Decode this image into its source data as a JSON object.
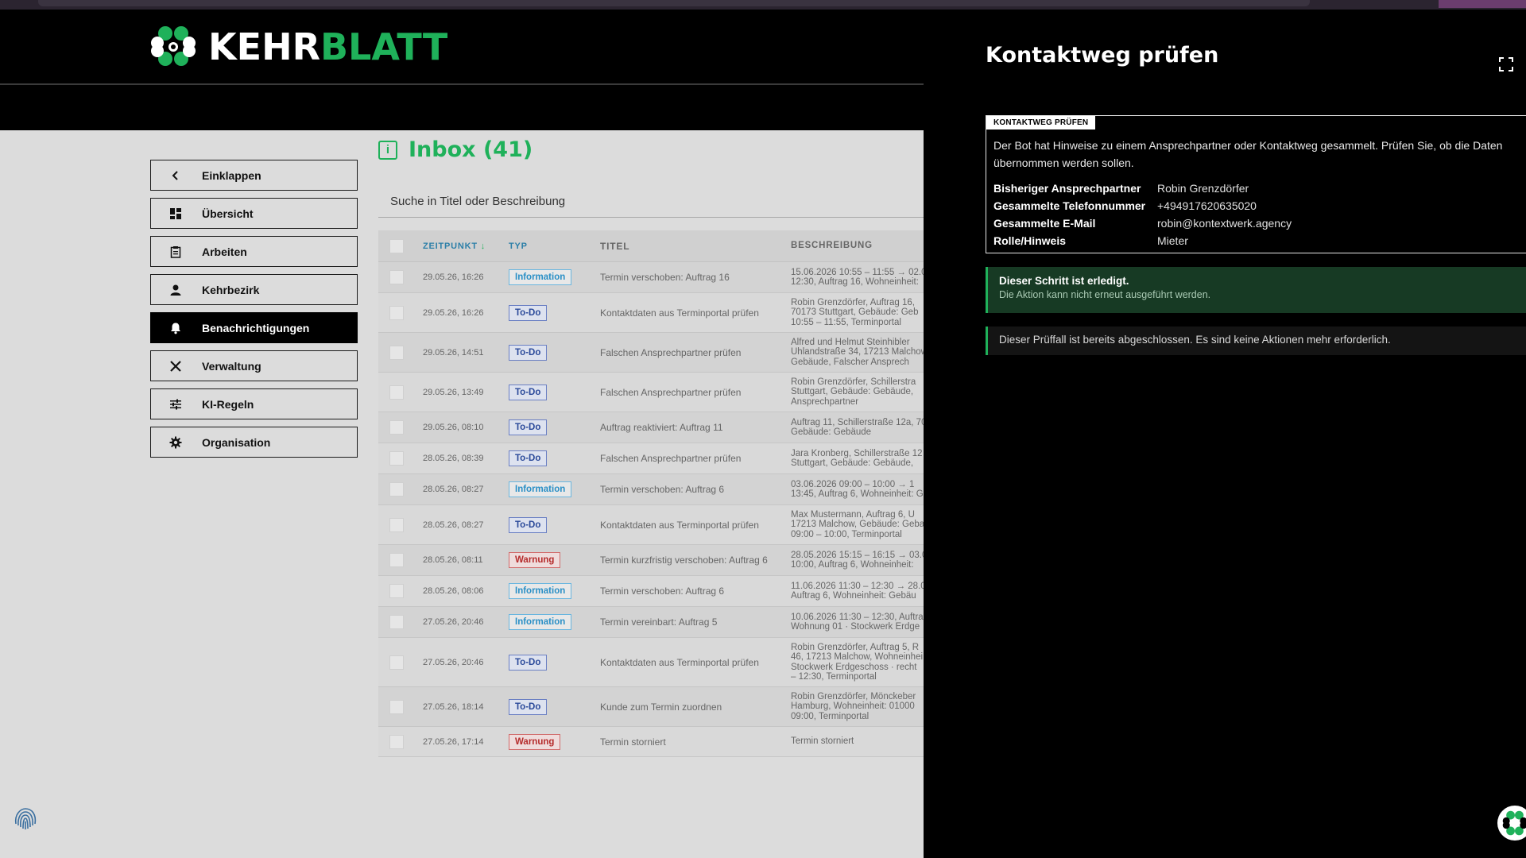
{
  "brand": {
    "name_part1": "KEHR",
    "name_part2": "BLATT",
    "primary_color": "#1fb15a"
  },
  "sidebar": {
    "items": [
      {
        "label": "Einklappen",
        "icon": "chevron-left-icon",
        "active": false
      },
      {
        "label": "Übersicht",
        "icon": "dashboard-icon",
        "active": false
      },
      {
        "label": "Arbeiten",
        "icon": "clipboard-icon",
        "active": false
      },
      {
        "label": "Kehrbezirk",
        "icon": "person-icon",
        "active": false
      },
      {
        "label": "Benachrichtigungen",
        "icon": "bell-icon",
        "active": true
      },
      {
        "label": "Verwaltung",
        "icon": "tools-icon",
        "active": false
      },
      {
        "label": "KI-Regeln",
        "icon": "sliders-icon",
        "active": false
      },
      {
        "label": "Organisation",
        "icon": "gear-icon",
        "active": false
      }
    ]
  },
  "inbox": {
    "title": "Inbox (41)",
    "search_placeholder": "Suche in Titel oder Beschreibung",
    "columns": {
      "time": "ZEITPUNKT",
      "type": "TYP",
      "title": "TITEL",
      "desc": "BESCHREIBUNG"
    },
    "rows": [
      {
        "time": "29.05.26, 16:26",
        "type": "Information",
        "kind": "info",
        "title": "Termin verschoben: Auftrag 16",
        "desc": [
          "15.06.2026 10:55 – 11:55 → 02.0",
          "12:30, Auftrag 16, Wohneinheit:"
        ]
      },
      {
        "time": "29.05.26, 16:26",
        "type": "To-Do",
        "kind": "todo",
        "title": "Kontaktdaten aus Terminportal prüfen",
        "desc": [
          "Robin Grenzdörfer, Auftrag 16,",
          "70173 Stuttgart, Gebäude: Geb",
          "10:55 – 11:55, Terminportal"
        ]
      },
      {
        "time": "29.05.26, 14:51",
        "type": "To-Do",
        "kind": "todo",
        "title": "Falschen Ansprechpartner prüfen",
        "desc": [
          "Alfred und Helmut Steinhibler",
          "Uhlandstraße 34, 17213 Malchow",
          "Gebäude, Falscher Ansprech"
        ]
      },
      {
        "time": "29.05.26, 13:49",
        "type": "To-Do",
        "kind": "todo",
        "title": "Falschen Ansprechpartner prüfen",
        "desc": [
          "Robin Grenzdörfer, Schillerstra",
          "Stuttgart, Gebäude: Gebäude,",
          "Ansprechpartner"
        ]
      },
      {
        "time": "29.05.26, 08:10",
        "type": "To-Do",
        "kind": "todo",
        "title": "Auftrag reaktiviert: Auftrag 11",
        "desc": [
          "Auftrag 11, Schillerstraße 12a, 70",
          "Gebäude: Gebäude"
        ]
      },
      {
        "time": "28.05.26, 08:39",
        "type": "To-Do",
        "kind": "todo",
        "title": "Falschen Ansprechpartner prüfen",
        "desc": [
          "Jara Kronberg, Schillerstraße 12",
          "Stuttgart, Gebäude: Gebäude,"
        ]
      },
      {
        "time": "28.05.26, 08:27",
        "type": "Information",
        "kind": "info",
        "title": "Termin verschoben: Auftrag 6",
        "desc": [
          "03.06.2026 09:00 – 10:00 → 1",
          "13:45, Auftrag 6, Wohneinheit: G"
        ]
      },
      {
        "time": "28.05.26, 08:27",
        "type": "To-Do",
        "kind": "todo",
        "title": "Kontaktdaten aus Terminportal prüfen",
        "desc": [
          "Max Mustermann, Auftrag 6, U",
          "17213 Malchow, Gebäude: Geba",
          "09:00 – 10:00, Terminportal"
        ]
      },
      {
        "time": "28.05.26, 08:11",
        "type": "Warnung",
        "kind": "warn",
        "title": "Termin kurzfristig verschoben: Auftrag 6",
        "desc": [
          "28.05.2026 15:15 – 16:15 → 03.0",
          "10:00, Auftrag 6, Wohneinheit:"
        ]
      },
      {
        "time": "28.05.26, 08:06",
        "type": "Information",
        "kind": "info",
        "title": "Termin verschoben: Auftrag 6",
        "desc": [
          "11.06.2026 11:30 – 12:30 → 28.0",
          "Auftrag 6, Wohneinheit: Gebäu"
        ]
      },
      {
        "time": "27.05.26, 20:46",
        "type": "Information",
        "kind": "info",
        "title": "Termin vereinbart: Auftrag 5",
        "desc": [
          "10.06.2026 11:30 – 12:30, Auftrag",
          "Wohnung 01 · Stockwerk Erdge"
        ]
      },
      {
        "time": "27.05.26, 20:46",
        "type": "To-Do",
        "kind": "todo",
        "title": "Kontaktdaten aus Terminportal prüfen",
        "desc": [
          "Robin Grenzdörfer, Auftrag 5, R",
          "46, 17213 Malchow, Wohneinhei",
          "Stockwerk Erdgeschoss · recht",
          "– 12:30, Terminportal"
        ]
      },
      {
        "time": "27.05.26, 18:14",
        "type": "To-Do",
        "kind": "todo",
        "title": "Kunde zum Termin zuordnen",
        "desc": [
          "Robin Grenzdörfer, Mönckeber",
          "Hamburg, Wohneinheit: 01000",
          "09:00, Terminportal"
        ]
      },
      {
        "time": "27.05.26, 17:14",
        "type": "Warnung",
        "kind": "warn",
        "title": "Termin storniert",
        "desc": [
          "Termin storniert"
        ]
      }
    ]
  },
  "panel": {
    "title": "Kontaktweg prüfen",
    "card_tag": "KONTAKTWEG PRÜFEN",
    "card_text": "Der Bot hat Hinweise zu einem Ansprechpartner oder Kontaktweg gesammelt. Prüfen Sie, ob die Daten übernommen werden sollen.",
    "fields": [
      {
        "key": "Bisheriger Ansprechpartner",
        "value": "Robin Grenzdörfer"
      },
      {
        "key": "Gesammelte Telefonnummer",
        "value": "+494917620635020"
      },
      {
        "key": "Gesammelte E-Mail",
        "value": "robin@kontextwerk.agency"
      },
      {
        "key": "Rolle/Hinweis",
        "value": "Mieter"
      }
    ],
    "done_title": "Dieser Schritt ist erledigt.",
    "done_sub": "Die Aktion kann nicht erneut ausgeführt werden.",
    "closed_text": "Dieser Prüffall ist bereits abgeschlossen. Es sind keine Aktionen mehr erforderlich."
  }
}
